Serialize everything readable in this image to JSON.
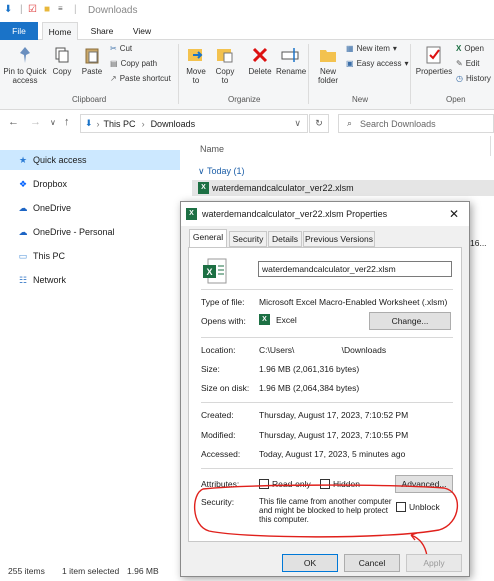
{
  "window": {
    "title": "Downloads"
  },
  "tabs": {
    "file": "File",
    "home": "Home",
    "share": "Share",
    "view": "View"
  },
  "ribbon": {
    "pin": "Pin to Quick access",
    "copy": "Copy",
    "paste": "Paste",
    "cut": "Cut",
    "copy_path": "Copy path",
    "paste_shortcut": "Paste shortcut",
    "clipboard": "Clipboard",
    "move_to": "Move to",
    "copy_to": "Copy to",
    "delete": "Delete",
    "rename": "Rename",
    "organize": "Organize",
    "new_folder": "New folder",
    "new_item": "New item",
    "easy_access": "Easy access",
    "new_group": "New",
    "properties": "Properties",
    "open": "Open",
    "edit": "Edit",
    "history": "History",
    "open_group": "Open"
  },
  "address": {
    "part1": "This PC",
    "part2": "Downloads",
    "search_placeholder": "Search Downloads"
  },
  "sidebar": {
    "items": [
      {
        "label": "Quick access",
        "icon": "star-icon"
      },
      {
        "label": "Dropbox",
        "icon": "dropbox-icon"
      },
      {
        "label": "OneDrive",
        "icon": "cloud-icon"
      },
      {
        "label": "OneDrive - Personal",
        "icon": "cloud-icon"
      },
      {
        "label": "This PC",
        "icon": "computer-icon"
      },
      {
        "label": "Network",
        "icon": "network-icon"
      }
    ]
  },
  "filelist": {
    "column_name": "Name",
    "group": "Today (1)",
    "file": "waterdemandcalculator_ver22.xlsm",
    "partial": "16..."
  },
  "status": {
    "count": "255 items",
    "selected": "1 item selected",
    "size": "1.96 MB"
  },
  "dialog": {
    "title": "waterdemandcalculator_ver22.xlsm Properties",
    "tabs": [
      "General",
      "Security",
      "Details",
      "Previous Versions"
    ],
    "filename": "waterdemandcalculator_ver22.xlsm",
    "type_label": "Type of file:",
    "type_value": "Microsoft Excel Macro-Enabled Worksheet (.xlsm)",
    "opens_label": "Opens with:",
    "opens_value": "Excel",
    "change": "Change...",
    "location_label": "Location:",
    "location_value": "C:\\Users\\                    \\Downloads",
    "size_label": "Size:",
    "size_value": "1.96 MB (2,061,316 bytes)",
    "disk_label": "Size on disk:",
    "disk_value": "1.96 MB (2,064,384 bytes)",
    "created_label": "Created:",
    "created_value": "Thursday, August 17, 2023, 7:10:52 PM",
    "modified_label": "Modified:",
    "modified_value": "Thursday, August 17, 2023, 7:10:55 PM",
    "accessed_label": "Accessed:",
    "accessed_value": "Today, August 17, 2023, 5 minutes ago",
    "attributes_label": "Attributes:",
    "readonly": "Read-only",
    "hidden": "Hidden",
    "advanced": "Advanced...",
    "security_label": "Security:",
    "security_text": "This file came from another computer and might be blocked to help protect this computer.",
    "unblock": "Unblock",
    "ok": "OK",
    "cancel": "Cancel",
    "apply": "Apply"
  },
  "colors": {
    "accent": "#1a73c8",
    "annotation": "#e0201b",
    "excel": "#1d7044"
  }
}
